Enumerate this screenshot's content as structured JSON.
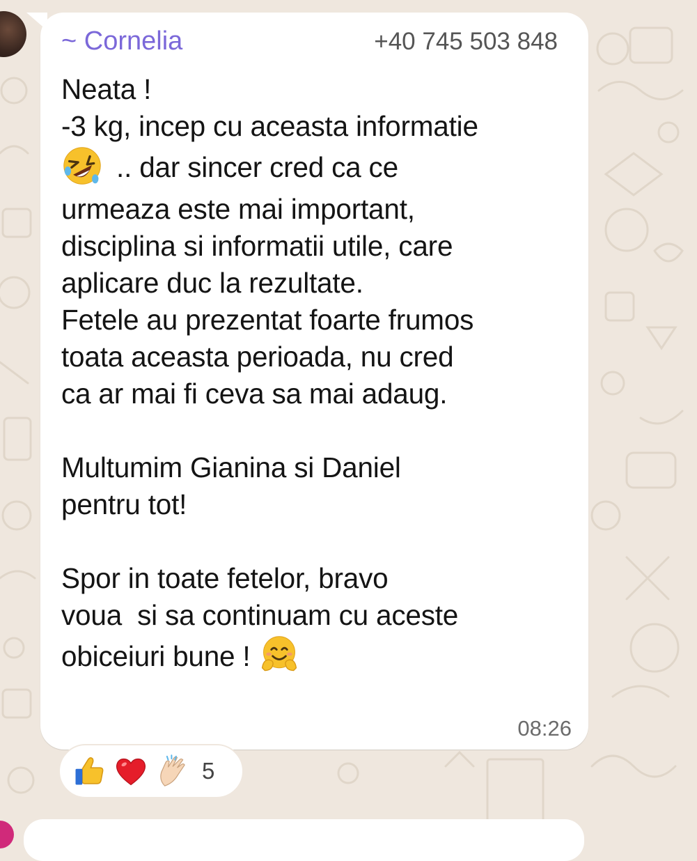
{
  "message": {
    "sender_name": "~ Cornelia",
    "sender_phone": "+40 745 503 848",
    "lines": [
      "Neata !",
      "-3 kg, incep cu aceasta informatie",
      " .. dar sincer cred ca ce",
      "urmeaza este mai important,",
      "disciplina si informatii utile, care",
      "aplicare duc la rezultate.",
      "Fetele au prezentat foarte frumos",
      "toata aceasta perioada, nu cred",
      "ca ar mai fi ceva sa mai adaug.",
      "",
      "Multumim Gianina si Daniel",
      "pentru tot!",
      "",
      "Spor in toate fetelor, bravo",
      "voua  si sa continuam cu aceste",
      "obiceiuri bune ! "
    ],
    "emoji_laugh": "rolling-on-floor-laughing-emoji",
    "emoji_hug": "hugging-face-emoji",
    "time": "08:26"
  },
  "reactions": {
    "emojis": [
      "thumbs-up-emoji",
      "red-heart-emoji",
      "clapping-hands-emoji"
    ],
    "count": "5"
  },
  "colors": {
    "sender_name": "#7b68d9",
    "background": "#efe7de",
    "bubble": "#ffffff"
  }
}
